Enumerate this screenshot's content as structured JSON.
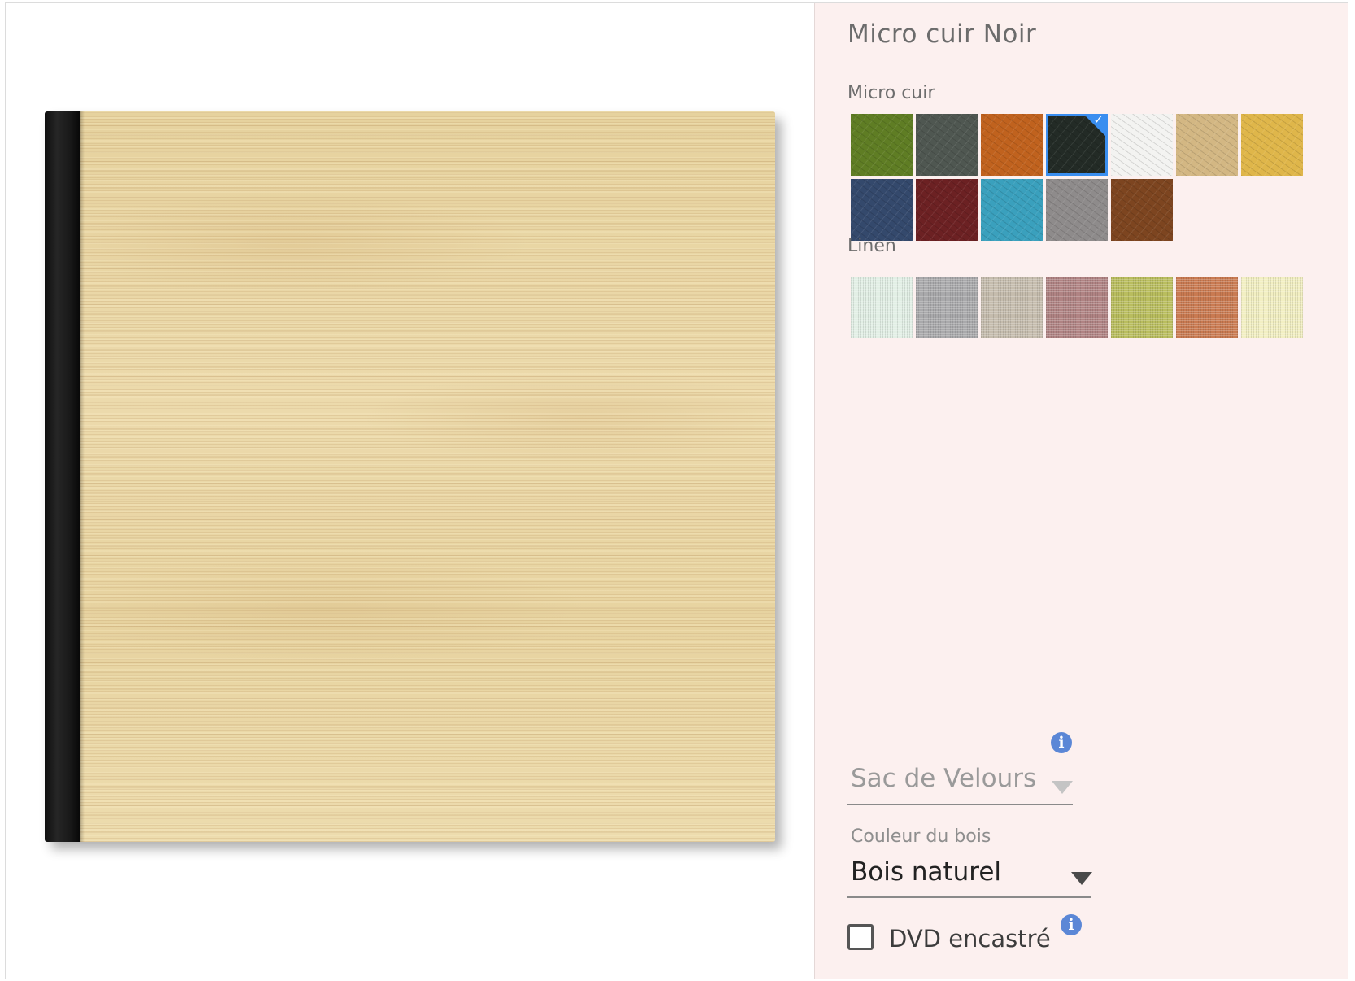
{
  "panel": {
    "title": "Micro cuir Noir",
    "sections": [
      {
        "label": "Micro cuir",
        "swatches": [
          {
            "name": "olive",
            "color": "#5f7d24"
          },
          {
            "name": "dark-grey",
            "color": "#4f5751"
          },
          {
            "name": "orange",
            "color": "#c0621e"
          },
          {
            "name": "noir",
            "color": "#232b26",
            "selected": true
          },
          {
            "name": "white",
            "color": "#f3f3f1"
          },
          {
            "name": "beige",
            "color": "#d3b783"
          },
          {
            "name": "yellow",
            "color": "#dfb64a"
          },
          {
            "name": "navy",
            "color": "#34496c"
          },
          {
            "name": "burgundy",
            "color": "#6c2123"
          },
          {
            "name": "turquoise",
            "color": "#3aa0bd"
          },
          {
            "name": "grey",
            "color": "#8e8b8b"
          },
          {
            "name": "brown",
            "color": "#7d4520"
          }
        ]
      },
      {
        "label": "Linen",
        "swatches": [
          {
            "name": "mint-white",
            "color": "#e2efe5"
          },
          {
            "name": "silver",
            "color": "#a9a9ab"
          },
          {
            "name": "taupe",
            "color": "#c5bcad"
          },
          {
            "name": "mauve",
            "color": "#b08383"
          },
          {
            "name": "lime",
            "color": "#b9bd5e"
          },
          {
            "name": "terracotta",
            "color": "#c97a51"
          },
          {
            "name": "cream",
            "color": "#f2efc2"
          }
        ]
      }
    ],
    "velvet_bag": {
      "value": "Sac de Velours"
    },
    "wood_color": {
      "label": "Couleur du bois",
      "value": "Bois naturel"
    },
    "dvd": {
      "label": "DVD encastré",
      "checked": false
    },
    "colors": {
      "accent": "#3a8ef0",
      "info": "#5b87d6",
      "panel_bg": "#fcf0ef"
    }
  }
}
